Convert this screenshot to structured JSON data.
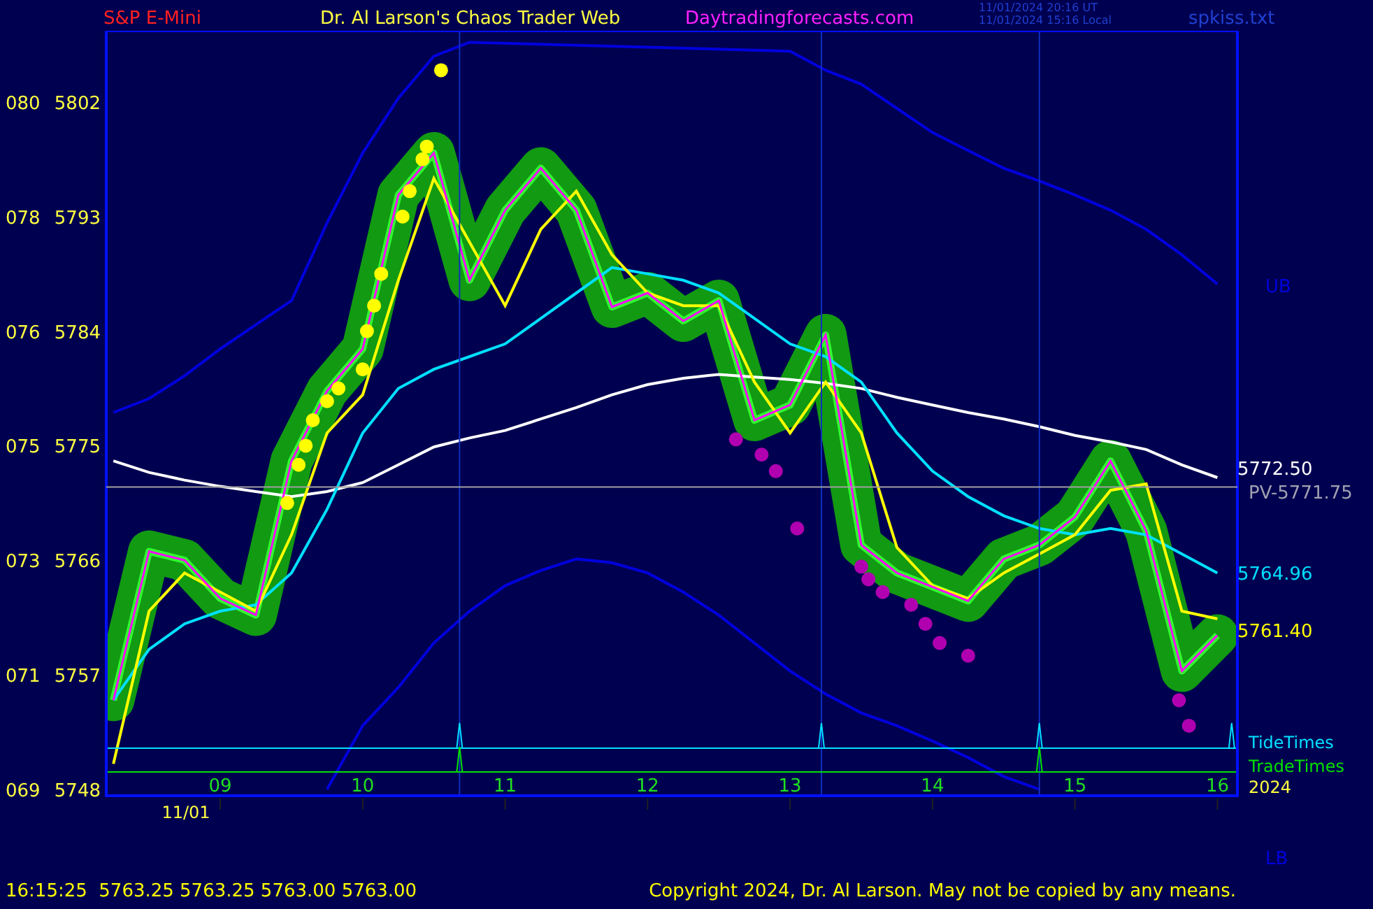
{
  "header": {
    "symbol": "S&P E-Mini",
    "title": "Dr. Al Larson's Chaos Trader Web",
    "site": "Daytradingforecasts.com",
    "time_ut": "11/01/2024 20:16  UT",
    "time_local": "11/01/2024 15:16  Local",
    "file": "spkiss.txt"
  },
  "chart": {
    "chart_data": {
      "type": "line",
      "xlim": [
        8.2,
        16.14
      ],
      "ylim": [
        5747.5,
        5807.6
      ],
      "x": [
        8.25,
        8.5,
        8.75,
        9,
        9.25,
        9.5,
        9.75,
        10,
        10.25,
        10.5,
        10.75,
        11,
        11.25,
        11.5,
        11.75,
        12,
        12.25,
        12.5,
        12.75,
        13,
        13.25,
        13.5,
        13.75,
        14,
        14.25,
        14.5,
        14.75,
        15,
        15.25,
        15.5,
        15.75,
        16
      ],
      "series": [
        {
          "name": "UB",
          "color": "#0000dd",
          "values": [
            5777.6,
            5778.7,
            5780.5,
            5782.6,
            5784.5,
            5786.4,
            5792.5,
            5798,
            5802.3,
            5805.6,
            5806.7,
            null,
            null,
            null,
            null,
            null,
            null,
            null,
            null,
            5806,
            5804.5,
            5803.4,
            5801.5,
            5799.6,
            5798.2,
            5796.8,
            5795.8,
            5794.7,
            5793.5,
            5792,
            5790,
            5787.7
          ]
        },
        {
          "name": "LB",
          "color": "#0000dd",
          "values": [
            null,
            null,
            null,
            null,
            null,
            null,
            5748,
            5753,
            5756,
            5759.5,
            5762,
            5764,
            5765.2,
            5766.1,
            5765.8,
            5765,
            5763.5,
            5761.7,
            5759.5,
            5757.3,
            5755.5,
            5754,
            5753,
            5751.8,
            5750.5,
            5749,
            5748,
            null,
            null,
            null,
            null,
            null
          ]
        },
        {
          "name": "5772.50",
          "color": "#ffffff",
          "values": [
            5773.8,
            5772.9,
            5772.3,
            5771.8,
            5771.4,
            5771,
            5771.4,
            5772.1,
            5773.5,
            5774.9,
            5775.6,
            5776.2,
            5777.1,
            5778,
            5779,
            5779.8,
            5780.3,
            5780.6,
            5780.4,
            5780.2,
            5779.9,
            5779.5,
            5778.8,
            5778.2,
            5777.6,
            5777.1,
            5776.5,
            5775.8,
            5775.3,
            5774.7,
            5773.5,
            5772.5
          ]
        },
        {
          "name": "5764.96",
          "color": "#00e0ff",
          "values": [
            5755,
            5759,
            5761,
            5762,
            5762.5,
            5765,
            5770,
            5776,
            5779.5,
            5781,
            5782,
            5783,
            5785,
            5787,
            5789,
            5788.5,
            5788,
            5787,
            5785,
            5783,
            5782,
            5780,
            5776,
            5773,
            5771,
            5769.5,
            5768.5,
            5768,
            5768.5,
            5768,
            5766.5,
            5765
          ]
        },
        {
          "name": "5761.40",
          "color": "#ffff00",
          "values": [
            5750,
            5762,
            5765,
            5763.5,
            5762,
            5768,
            5776,
            5779,
            5788,
            5796,
            5791,
            5786,
            5792,
            5795,
            5790,
            5787,
            5786,
            5786,
            5780,
            5776,
            5780,
            5776,
            5767,
            5764,
            5763,
            5765,
            5766.5,
            5768,
            5771.5,
            5772,
            5762,
            5761.4
          ]
        },
        {
          "color": "#ff00ff",
          "values": [
            5755,
            5766.7,
            5766,
            5763,
            5761.7,
            5773.8,
            5779.3,
            5782.6,
            5794.7,
            5798,
            5788,
            5793.5,
            5796.8,
            5793.5,
            5785.9,
            5787,
            5784.8,
            5786.4,
            5777,
            5778.2,
            5783.7,
            5767.2,
            5765,
            5763.9,
            5762.8,
            5766.1,
            5767.2,
            5769.4,
            5773.8,
            5768.3,
            5757.3,
            5760.1
          ]
        }
      ],
      "yticks": [
        5802,
        5793,
        5784,
        5775,
        5766,
        5757,
        5748
      ],
      "xticks": [
        {
          "value": 9,
          "label": "09"
        },
        {
          "value": 10,
          "label": "10"
        },
        {
          "value": 11,
          "label": "11"
        },
        {
          "value": 12,
          "label": "12"
        },
        {
          "value": 13,
          "label": "13"
        },
        {
          "value": 14,
          "label": "14"
        },
        {
          "value": 15,
          "label": "15"
        },
        {
          "value": 16,
          "label": "16"
        }
      ]
    },
    "pivot_label": "PV-5771.75",
    "y_codes": [
      "080",
      "078",
      "076",
      "075",
      "073",
      "071",
      "069"
    ],
    "date_label": "11/01",
    "tide_label": "TideTimes",
    "trade_label": "TradeTimes",
    "year_label": "2024"
  },
  "footer": {
    "quote": "16:15:25  5763.25 5763.25 5763.00 5763.00",
    "copyright": "Copyright 2024, Dr. Al Larson. May not be copied by any means."
  }
}
